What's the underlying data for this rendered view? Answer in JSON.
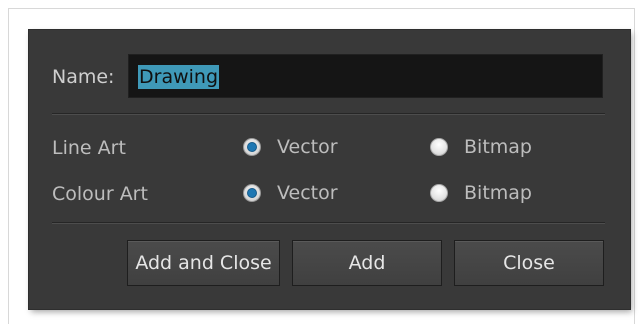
{
  "dialog": {
    "name_label": "Name:",
    "name_value": "Drawing",
    "line_art": {
      "label": "Line Art",
      "option_vector": "Vector",
      "option_bitmap": "Bitmap",
      "selected": "Vector"
    },
    "colour_art": {
      "label": "Colour Art",
      "option_vector": "Vector",
      "option_bitmap": "Bitmap",
      "selected": "Vector"
    },
    "buttons": {
      "add_and_close": "Add and Close",
      "add": "Add",
      "close": "Close"
    }
  },
  "colors": {
    "dialog_bg": "#393939",
    "input_bg": "#151515",
    "selection_highlight": "#3f99b8",
    "radio_selected_dot": "#1f78b3"
  }
}
